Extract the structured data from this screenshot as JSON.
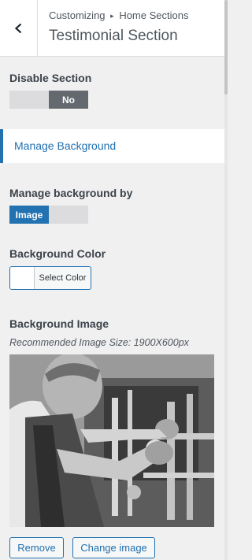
{
  "header": {
    "breadcrumb_root": "Customizing",
    "breadcrumb_separator": "▸",
    "breadcrumb_parent": "Home Sections",
    "title": "Testimonial Section"
  },
  "disable_section": {
    "label": "Disable Section",
    "value": "No"
  },
  "manage_background_section": {
    "label": "Manage Background"
  },
  "manage_background_by": {
    "label": "Manage background by",
    "value": "Image"
  },
  "background_color": {
    "label": "Background Color",
    "button_label": "Select Color",
    "swatch_color": "#ffffff"
  },
  "background_image": {
    "label": "Background Image",
    "note": "Recommended Image Size: 1900X600px",
    "remove_label": "Remove",
    "change_label": "Change image"
  },
  "colors": {
    "accent": "#2271b1",
    "toggle_active_dark": "#646970",
    "toggle_inactive": "#dcdcde"
  }
}
